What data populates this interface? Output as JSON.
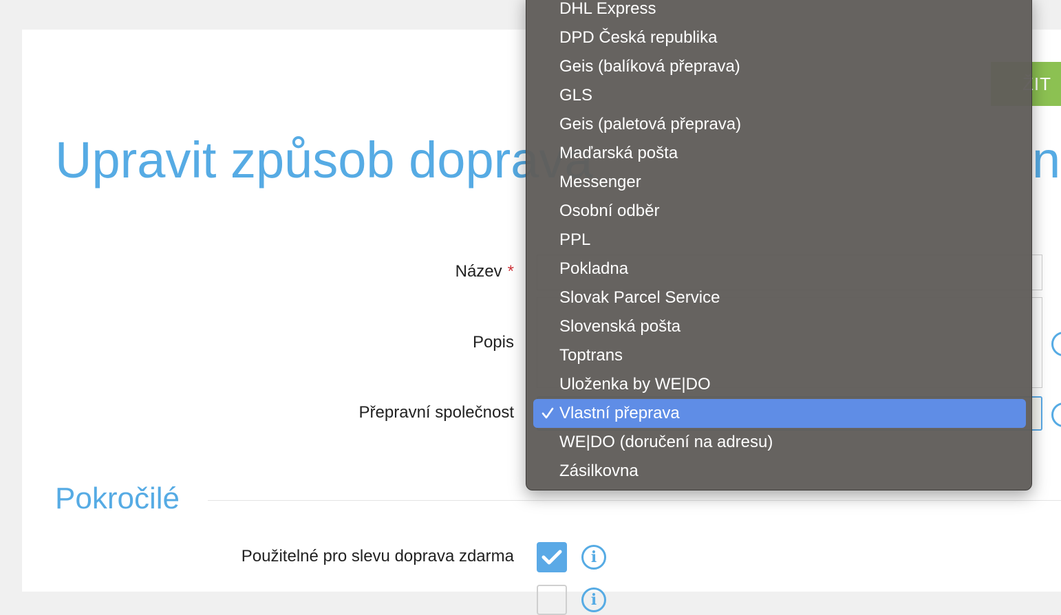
{
  "header": {
    "save_label": "ŽIT"
  },
  "page": {
    "title": "Upravit způsob doprava",
    "title_end": "ní"
  },
  "form": {
    "name_label": "Název",
    "required_mark": "*",
    "description_label": "Popis",
    "carrier_label": "Přepravní společnost",
    "selected_carrier": "Vlastní přeprava"
  },
  "carrier_dropdown": {
    "options": [
      "DHL Express",
      "DPD Česká republika",
      "Geis (balíková přeprava)",
      "GLS",
      "Geis (paletová přeprava)",
      "Maďarská pošta",
      "Messenger",
      "Osobní odběr",
      "PPL",
      "Pokladna",
      "Slovak Parcel Service",
      "Slovenská pošta",
      "Toptrans",
      "Uloženka by WE|DO",
      "Vlastní přeprava",
      "WE|DO (doručení na adresu)",
      "Zásilkovna"
    ],
    "selected_index": 14
  },
  "advanced": {
    "section_title": "Pokročilé",
    "free_shipping_label": "Použitelné pro slevu doprava zdarma",
    "free_shipping_checked": true
  },
  "icons": {
    "info": "info-icon",
    "check": "checkmark-icon"
  },
  "colors": {
    "accent": "#56abe4",
    "save": "#8cc152",
    "selected": "#5f8de6"
  }
}
